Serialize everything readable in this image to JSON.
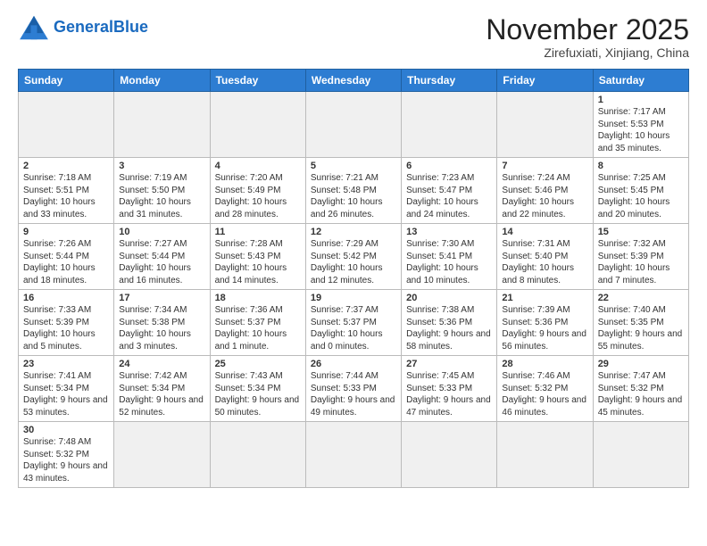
{
  "header": {
    "logo_general": "General",
    "logo_blue": "Blue",
    "month_title": "November 2025",
    "subtitle": "Zirefuxiati, Xinjiang, China"
  },
  "weekdays": [
    "Sunday",
    "Monday",
    "Tuesday",
    "Wednesday",
    "Thursday",
    "Friday",
    "Saturday"
  ],
  "weeks": [
    [
      {
        "day": "",
        "empty": true
      },
      {
        "day": "",
        "empty": true
      },
      {
        "day": "",
        "empty": true
      },
      {
        "day": "",
        "empty": true
      },
      {
        "day": "",
        "empty": true
      },
      {
        "day": "",
        "empty": true
      },
      {
        "day": "1",
        "sunrise": "Sunrise: 7:17 AM",
        "sunset": "Sunset: 5:53 PM",
        "daylight": "Daylight: 10 hours and 35 minutes."
      }
    ],
    [
      {
        "day": "2",
        "sunrise": "Sunrise: 7:18 AM",
        "sunset": "Sunset: 5:51 PM",
        "daylight": "Daylight: 10 hours and 33 minutes."
      },
      {
        "day": "3",
        "sunrise": "Sunrise: 7:19 AM",
        "sunset": "Sunset: 5:50 PM",
        "daylight": "Daylight: 10 hours and 31 minutes."
      },
      {
        "day": "4",
        "sunrise": "Sunrise: 7:20 AM",
        "sunset": "Sunset: 5:49 PM",
        "daylight": "Daylight: 10 hours and 28 minutes."
      },
      {
        "day": "5",
        "sunrise": "Sunrise: 7:21 AM",
        "sunset": "Sunset: 5:48 PM",
        "daylight": "Daylight: 10 hours and 26 minutes."
      },
      {
        "day": "6",
        "sunrise": "Sunrise: 7:23 AM",
        "sunset": "Sunset: 5:47 PM",
        "daylight": "Daylight: 10 hours and 24 minutes."
      },
      {
        "day": "7",
        "sunrise": "Sunrise: 7:24 AM",
        "sunset": "Sunset: 5:46 PM",
        "daylight": "Daylight: 10 hours and 22 minutes."
      },
      {
        "day": "8",
        "sunrise": "Sunrise: 7:25 AM",
        "sunset": "Sunset: 5:45 PM",
        "daylight": "Daylight: 10 hours and 20 minutes."
      }
    ],
    [
      {
        "day": "9",
        "sunrise": "Sunrise: 7:26 AM",
        "sunset": "Sunset: 5:44 PM",
        "daylight": "Daylight: 10 hours and 18 minutes."
      },
      {
        "day": "10",
        "sunrise": "Sunrise: 7:27 AM",
        "sunset": "Sunset: 5:44 PM",
        "daylight": "Daylight: 10 hours and 16 minutes."
      },
      {
        "day": "11",
        "sunrise": "Sunrise: 7:28 AM",
        "sunset": "Sunset: 5:43 PM",
        "daylight": "Daylight: 10 hours and 14 minutes."
      },
      {
        "day": "12",
        "sunrise": "Sunrise: 7:29 AM",
        "sunset": "Sunset: 5:42 PM",
        "daylight": "Daylight: 10 hours and 12 minutes."
      },
      {
        "day": "13",
        "sunrise": "Sunrise: 7:30 AM",
        "sunset": "Sunset: 5:41 PM",
        "daylight": "Daylight: 10 hours and 10 minutes."
      },
      {
        "day": "14",
        "sunrise": "Sunrise: 7:31 AM",
        "sunset": "Sunset: 5:40 PM",
        "daylight": "Daylight: 10 hours and 8 minutes."
      },
      {
        "day": "15",
        "sunrise": "Sunrise: 7:32 AM",
        "sunset": "Sunset: 5:39 PM",
        "daylight": "Daylight: 10 hours and 7 minutes."
      }
    ],
    [
      {
        "day": "16",
        "sunrise": "Sunrise: 7:33 AM",
        "sunset": "Sunset: 5:39 PM",
        "daylight": "Daylight: 10 hours and 5 minutes."
      },
      {
        "day": "17",
        "sunrise": "Sunrise: 7:34 AM",
        "sunset": "Sunset: 5:38 PM",
        "daylight": "Daylight: 10 hours and 3 minutes."
      },
      {
        "day": "18",
        "sunrise": "Sunrise: 7:36 AM",
        "sunset": "Sunset: 5:37 PM",
        "daylight": "Daylight: 10 hours and 1 minute."
      },
      {
        "day": "19",
        "sunrise": "Sunrise: 7:37 AM",
        "sunset": "Sunset: 5:37 PM",
        "daylight": "Daylight: 10 hours and 0 minutes."
      },
      {
        "day": "20",
        "sunrise": "Sunrise: 7:38 AM",
        "sunset": "Sunset: 5:36 PM",
        "daylight": "Daylight: 9 hours and 58 minutes."
      },
      {
        "day": "21",
        "sunrise": "Sunrise: 7:39 AM",
        "sunset": "Sunset: 5:36 PM",
        "daylight": "Daylight: 9 hours and 56 minutes."
      },
      {
        "day": "22",
        "sunrise": "Sunrise: 7:40 AM",
        "sunset": "Sunset: 5:35 PM",
        "daylight": "Daylight: 9 hours and 55 minutes."
      }
    ],
    [
      {
        "day": "23",
        "sunrise": "Sunrise: 7:41 AM",
        "sunset": "Sunset: 5:34 PM",
        "daylight": "Daylight: 9 hours and 53 minutes."
      },
      {
        "day": "24",
        "sunrise": "Sunrise: 7:42 AM",
        "sunset": "Sunset: 5:34 PM",
        "daylight": "Daylight: 9 hours and 52 minutes."
      },
      {
        "day": "25",
        "sunrise": "Sunrise: 7:43 AM",
        "sunset": "Sunset: 5:34 PM",
        "daylight": "Daylight: 9 hours and 50 minutes."
      },
      {
        "day": "26",
        "sunrise": "Sunrise: 7:44 AM",
        "sunset": "Sunset: 5:33 PM",
        "daylight": "Daylight: 9 hours and 49 minutes."
      },
      {
        "day": "27",
        "sunrise": "Sunrise: 7:45 AM",
        "sunset": "Sunset: 5:33 PM",
        "daylight": "Daylight: 9 hours and 47 minutes."
      },
      {
        "day": "28",
        "sunrise": "Sunrise: 7:46 AM",
        "sunset": "Sunset: 5:32 PM",
        "daylight": "Daylight: 9 hours and 46 minutes."
      },
      {
        "day": "29",
        "sunrise": "Sunrise: 7:47 AM",
        "sunset": "Sunset: 5:32 PM",
        "daylight": "Daylight: 9 hours and 45 minutes."
      }
    ],
    [
      {
        "day": "30",
        "sunrise": "Sunrise: 7:48 AM",
        "sunset": "Sunset: 5:32 PM",
        "daylight": "Daylight: 9 hours and 43 minutes."
      },
      {
        "day": "",
        "empty": true
      },
      {
        "day": "",
        "empty": true
      },
      {
        "day": "",
        "empty": true
      },
      {
        "day": "",
        "empty": true
      },
      {
        "day": "",
        "empty": true
      },
      {
        "day": "",
        "empty": true
      }
    ]
  ]
}
